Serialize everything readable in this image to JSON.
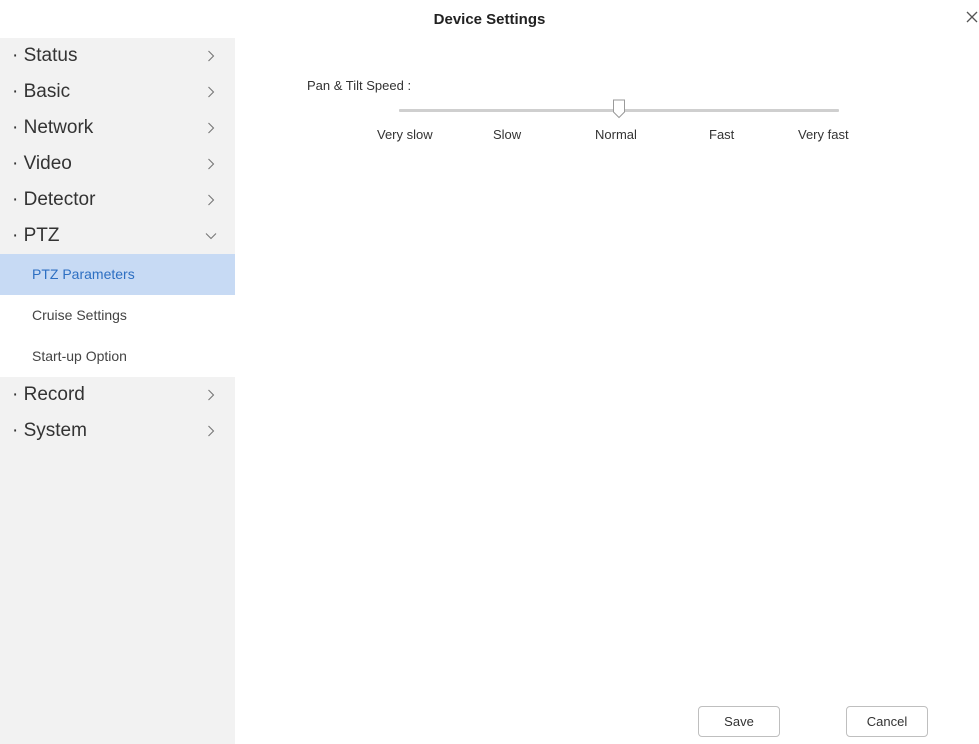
{
  "window": {
    "title": "Device Settings"
  },
  "sidebar": {
    "items": [
      {
        "label": "· Status"
      },
      {
        "label": "· Basic"
      },
      {
        "label": "· Network"
      },
      {
        "label": "· Video"
      },
      {
        "label": "· Detector"
      },
      {
        "label": "· PTZ",
        "expanded": true
      },
      {
        "label": "· Record"
      },
      {
        "label": "· System"
      }
    ],
    "ptz_subitems": [
      {
        "label": "PTZ Parameters",
        "selected": true
      },
      {
        "label": "Cruise Settings"
      },
      {
        "label": "Start-up Option"
      }
    ]
  },
  "main": {
    "speed_label": "Pan & Tilt Speed :",
    "speed_options": [
      "Very slow",
      "Slow",
      "Normal",
      "Fast",
      "Very fast"
    ],
    "speed_value": "Normal",
    "speed_level_index": 2
  },
  "footer": {
    "save_label": "Save",
    "cancel_label": "Cancel"
  },
  "colors": {
    "selected_bg": "#c7daf4",
    "selected_text": "#2d6fc2",
    "sidebar_bg": "#f2f2f2"
  }
}
